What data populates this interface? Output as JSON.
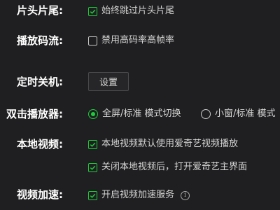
{
  "settings": {
    "opening_ending": {
      "label": "片头片尾:",
      "option": {
        "text": "始终跳过片头片尾",
        "checked": true
      }
    },
    "stream": {
      "label": "播放码流:",
      "option": {
        "text": "禁用高码率高帧率",
        "checked": false
      }
    },
    "timer": {
      "label": "定时关机:",
      "button": "设置"
    },
    "double_click": {
      "label": "双击播放器:",
      "options": [
        {
          "text": "全屏/标准 模式切换",
          "selected": true
        },
        {
          "text": "小窗/标准 模式",
          "selected": false
        }
      ]
    },
    "local_video": {
      "label": "本地视频:",
      "options": [
        {
          "text": "本地视频默认使用爱奇艺视频播放",
          "checked": true
        },
        {
          "text": "关闭本地视频后，打开爱奇艺主界面",
          "checked": true
        }
      ]
    },
    "acceleration": {
      "label": "视频加速:",
      "option": {
        "text": "开启视频加速服务",
        "checked": true
      },
      "info_icon": "i"
    }
  },
  "colors": {
    "accent": "#1ecc3c",
    "background": "#1f1f21"
  }
}
